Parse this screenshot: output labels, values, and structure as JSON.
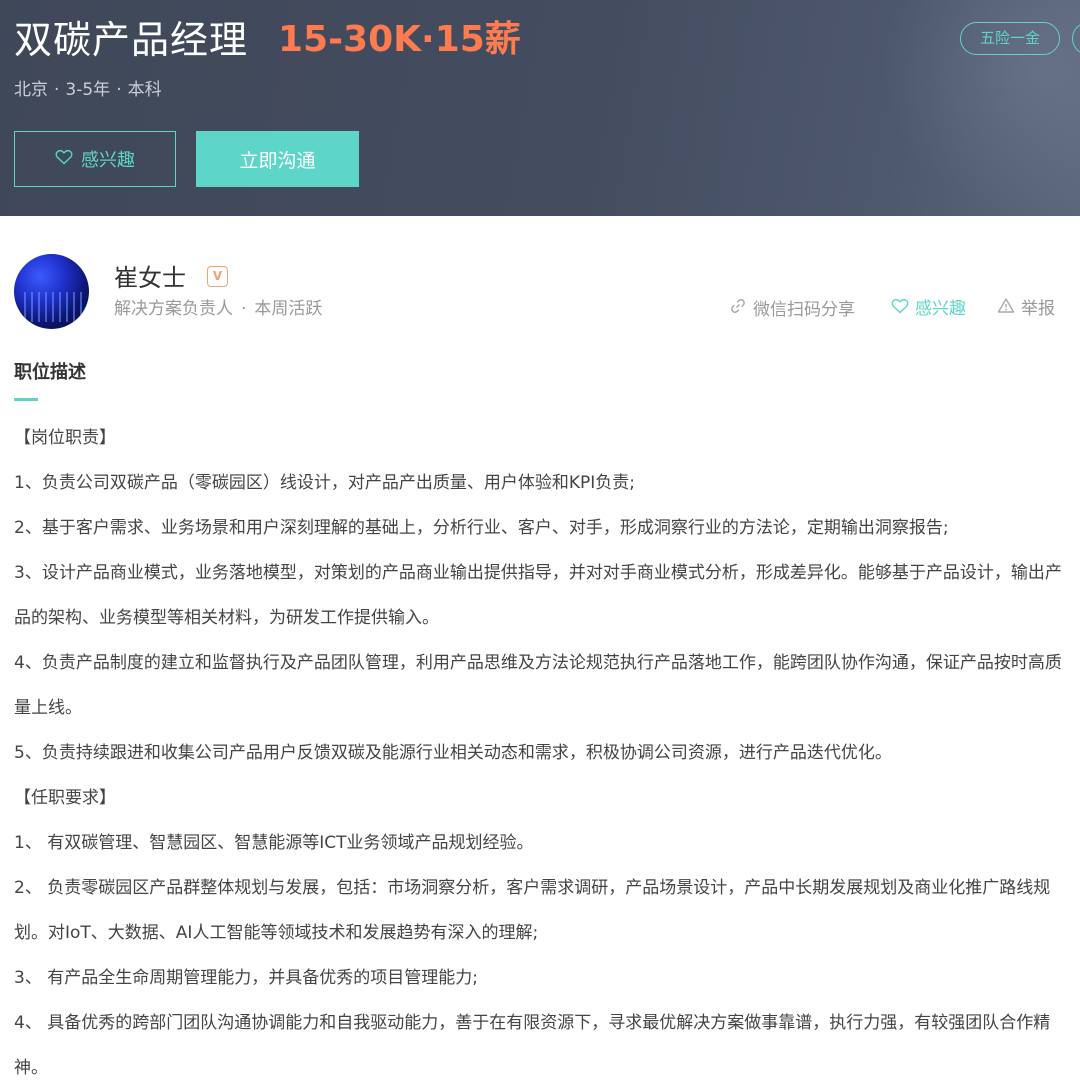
{
  "header": {
    "job_title": "双碳产品经理",
    "salary": "15-30K·15薪",
    "location": "北京",
    "experience": "3-5年",
    "education": "本科",
    "separator": "·",
    "tags": [
      "五险一金",
      ""
    ],
    "interest_button": "感兴趣",
    "chat_button": "立即沟通"
  },
  "recruiter": {
    "name": "崔女士",
    "badge": "V",
    "title": "解决方案负责人",
    "separator": "·",
    "status": "本周活跃"
  },
  "actions": {
    "share": "微信扫码分享",
    "interest": "感兴趣",
    "report": "举报"
  },
  "description": {
    "section_title": "职位描述",
    "lines": [
      "【岗位职责】",
      "1、负责公司双碳产品（零碳园区）线设计，对产品产出质量、用户体验和KPI负责;",
      "2、基于客户需求、业务场景和用户深刻理解的基础上，分析行业、客户、对手，形成洞察行业的方法论，定期输出洞察报告;",
      "3、设计产品商业模式，业务落地模型，对策划的产品商业输出提供指导，并对对手商业模式分析，形成差异化。能够基于产品设计，输出产品的架构、业务模型等相关材料，为研发工作提供输入。",
      "4、负责产品制度的建立和监督执行及产品团队管理，利用产品思维及方法论规范执行产品落地工作，能跨团队协作沟通，保证产品按时高质量上线。",
      "5、负责持续跟进和收集公司产品用户反馈双碳及能源行业相关动态和需求，积极协调公司资源，进行产品迭代优化。",
      "【任职要求】",
      "1、 有双碳管理、智慧园区、智慧能源等ICT业务领域产品规划经验。",
      "2、 负责零碳园区产品群整体规划与发展，包括：市场洞察分析，客户需求调研，产品场景设计，产品中长期发展规划及商业化推广路线规划。对IoT、大数据、AI人工智能等领域技术和发展趋势有深入的理解;",
      "3、 有产品全生命周期管理能力，并具备优秀的项目管理能力;",
      "4、 具备优秀的跨部门团队沟通协调能力和自我驱动能力，善于在有限资源下，寻求最优解决方案做事靠谱，执行力强，有较强团队合作精神。"
    ]
  },
  "colors": {
    "accent": "#5dd5c8",
    "salary": "#fe7a4f",
    "banner": "#444d60"
  }
}
